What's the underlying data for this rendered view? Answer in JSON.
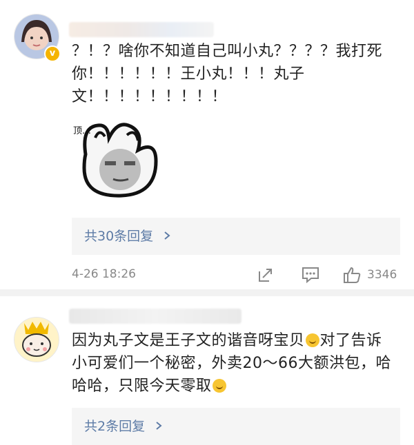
{
  "comments": [
    {
      "text": "？！？啥你不知道自己叫小丸？？？？我打死你！！！！！！王小丸！！！丸子文！！！！！！！！！",
      "reply_count_label": "共30条回复",
      "timestamp": "4-26 18:26",
      "like_count": "3346",
      "badge": "v"
    },
    {
      "text_parts": [
        "因为丸子文是王子文的谐音呀宝贝",
        "对了告诉小可爱们一个秘密，外卖20～66大额洪包，哈哈哈，只限今天零取",
        ""
      ],
      "reply_count_label": "共2条回复"
    }
  ],
  "icons": {
    "share": "share-icon",
    "comment": "comment-icon",
    "like": "thumbs-up-icon",
    "chevron": "chevron-right-icon",
    "emoji_a": "grin-emoji-icon",
    "emoji_b": "laugh-emoji-icon"
  },
  "colors": {
    "link": "#5d7ba6",
    "meta": "#888888",
    "badge": "#f5b400"
  }
}
